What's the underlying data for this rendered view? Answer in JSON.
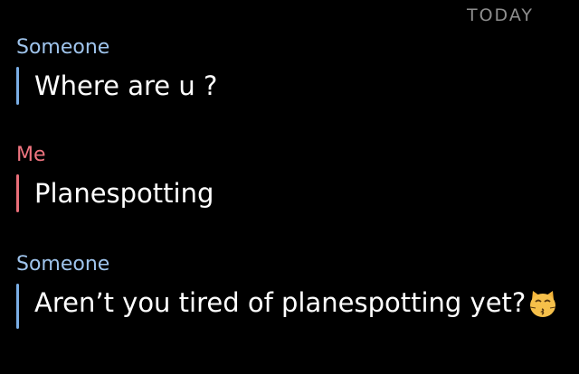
{
  "date_header": "TODAY",
  "messages": [
    {
      "sender": "Someone",
      "text": "Where are u ?"
    },
    {
      "sender": "Me",
      "text": "Planespotting"
    },
    {
      "sender": "Someone",
      "text": "Aren’t you tired of planespotting yet?",
      "emoji": "kissing-cat-emoji"
    }
  ],
  "colors": {
    "background": "#000000",
    "other_sender": "#9fc4ec",
    "me_sender": "#f07580",
    "date_header": "#8e8e8e"
  }
}
